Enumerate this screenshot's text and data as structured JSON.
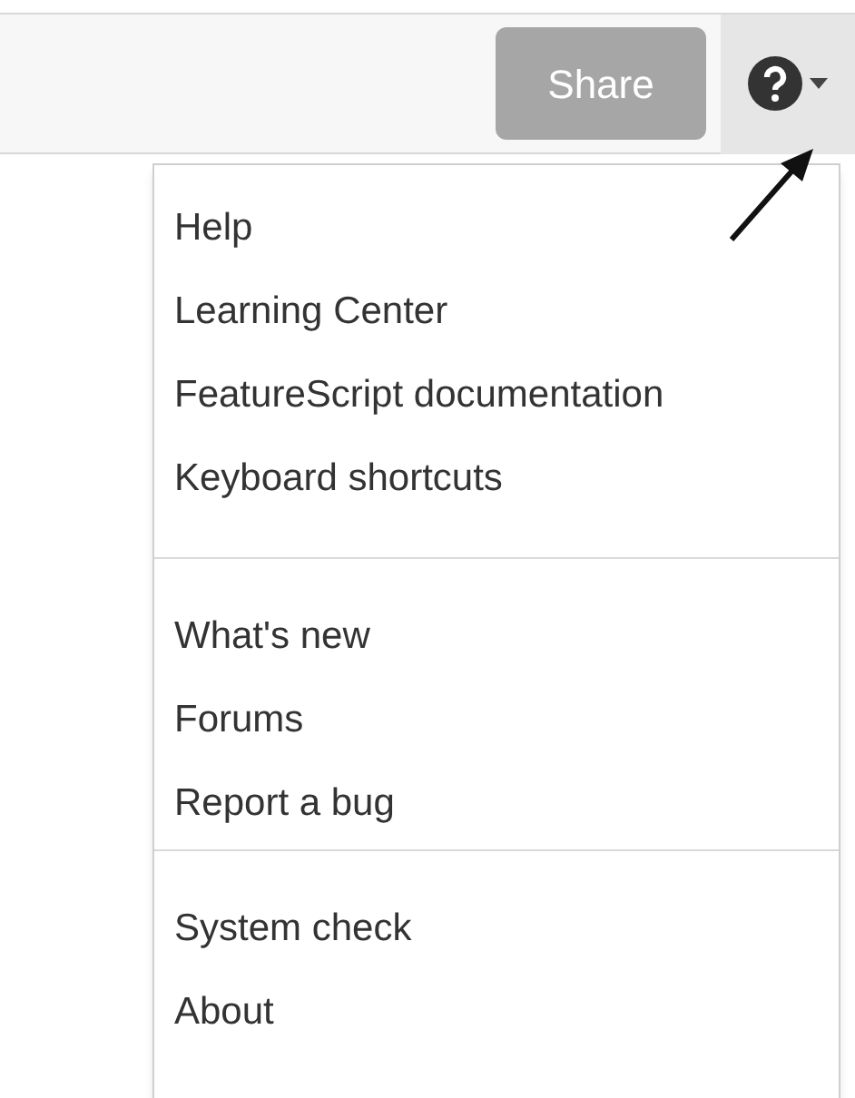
{
  "toolbar": {
    "share_button": "Share"
  },
  "help_menu": {
    "sections": [
      {
        "items": [
          "Help",
          "Learning Center",
          "FeatureScript documentation",
          "Keyboard shortcuts"
        ]
      },
      {
        "items": [
          "What's new",
          "Forums",
          "Report a bug"
        ]
      },
      {
        "items": [
          "System check",
          "About"
        ]
      }
    ]
  }
}
